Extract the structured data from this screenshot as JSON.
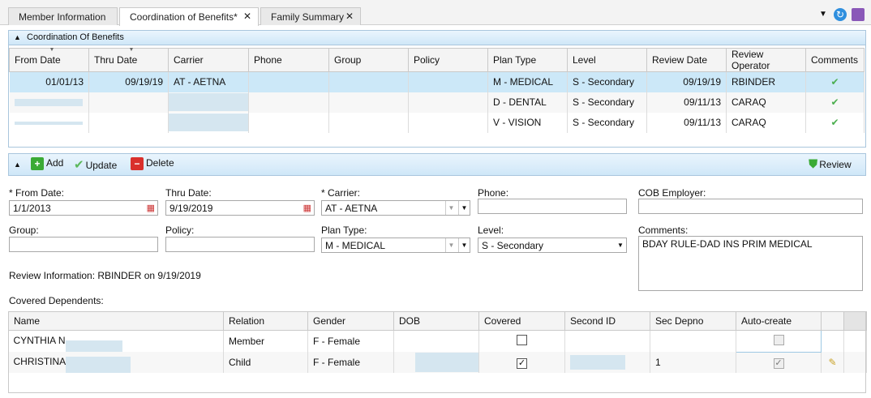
{
  "tabs": [
    {
      "label": "Member Information",
      "closable": false,
      "active": false
    },
    {
      "label": "Coordination of Benefits*",
      "closable": true,
      "active": true
    },
    {
      "label": "Family Summary",
      "closable": true,
      "active": false
    }
  ],
  "cob_panel": {
    "title": "Coordination Of Benefits",
    "columns": [
      "From Date",
      "Thru Date",
      "Carrier",
      "Phone",
      "Group",
      "Policy",
      "Plan Type",
      "Level",
      "Review Date",
      "Review Operator",
      "Comments"
    ],
    "rows": [
      {
        "from": "01/01/13",
        "thru": "09/19/19",
        "carrier": "AT - AETNA",
        "phone": "",
        "group": "",
        "policy": "",
        "plan_type": "M - MEDICAL",
        "level": "S - Secondary",
        "review_date": "09/19/19",
        "operator": "RBINDER",
        "comments": true
      },
      {
        "from": "",
        "thru": "",
        "carrier": "",
        "phone": "",
        "group": "",
        "policy": "",
        "plan_type": "D - DENTAL",
        "level": "S - Secondary",
        "review_date": "09/11/13",
        "operator": "CARAQ",
        "comments": true
      },
      {
        "from": "",
        "thru": "",
        "carrier": "",
        "phone": "",
        "group": "",
        "policy": "",
        "plan_type": "V - VISION",
        "level": "S - Secondary",
        "review_date": "09/11/13",
        "operator": "CARAQ",
        "comments": true
      }
    ]
  },
  "toolbar": {
    "add": "Add",
    "update": "Update",
    "delete": "Delete",
    "review": "Review"
  },
  "form": {
    "from_date_label": "* From Date:",
    "from_date": "1/1/2013",
    "thru_date_label": "Thru Date:",
    "thru_date": "9/19/2019",
    "carrier_label": "* Carrier:",
    "carrier": "AT - AETNA",
    "phone_label": "Phone:",
    "phone": "",
    "cob_employer_label": "COB Employer:",
    "cob_employer": "",
    "group_label": "Group:",
    "group": "",
    "policy_label": "Policy:",
    "policy": "",
    "plan_type_label": "Plan Type:",
    "plan_type": "M - MEDICAL",
    "level_label": "Level:",
    "level": "S - Secondary",
    "comments_label": "Comments:",
    "comments": "BDAY RULE-DAD INS PRIM MEDICAL",
    "review_info": "Review Information:  RBINDER  on   9/19/2019"
  },
  "dependents": {
    "title": "Covered Dependents:",
    "columns": [
      "Name",
      "Relation",
      "Gender",
      "DOB",
      "Covered",
      "Second ID",
      "Sec Depno",
      "Auto-create"
    ],
    "rows": [
      {
        "name": "CYNTHIA N",
        "relation": "Member",
        "gender": "F - Female",
        "dob": "",
        "covered": false,
        "second_id": "",
        "sec_depno": "",
        "auto_create": false
      },
      {
        "name": "CHRISTINA",
        "relation": "Child",
        "gender": "F - Female",
        "dob": "",
        "covered": true,
        "second_id": "",
        "sec_depno": "1",
        "auto_create": true
      }
    ]
  },
  "colors": {
    "accent": "#cce8f8",
    "check": "#4caf50",
    "add": "#3aaa35",
    "delete": "#d9302c"
  }
}
